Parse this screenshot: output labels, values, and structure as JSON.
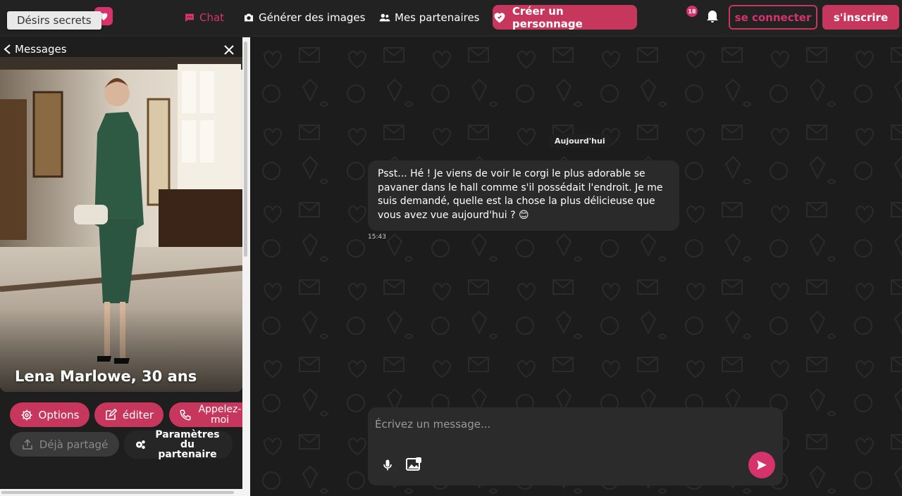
{
  "brand": {
    "tooltip": "Désirs secrets",
    "accent": "#c7375d"
  },
  "nav": {
    "chat": "Chat",
    "generate": "Générer des images",
    "partners": "Mes partenaires",
    "create": "Créer un personnage",
    "badge": "18",
    "login": "se connecter",
    "signup": "s'inscrire"
  },
  "panel": {
    "back": "Messages",
    "name": "Lena Marlowe, 30 ans",
    "options": "Options",
    "edit": "éditer",
    "call": "Appelez-moi",
    "shared": "Déjà partagé",
    "params": "Paramètres du partenaire"
  },
  "chat": {
    "day": "Aujourd'hui",
    "message": "Psst... Hé ! Je viens de voir le corgi le plus adorable se pavaner dans le hall comme s'il possédait l'endroit. Je me suis demandé, quelle est la chose la plus délicieuse que vous avez vue aujourd'hui ? 😊",
    "time": "15:43",
    "placeholder": "Écrivez un message..."
  }
}
